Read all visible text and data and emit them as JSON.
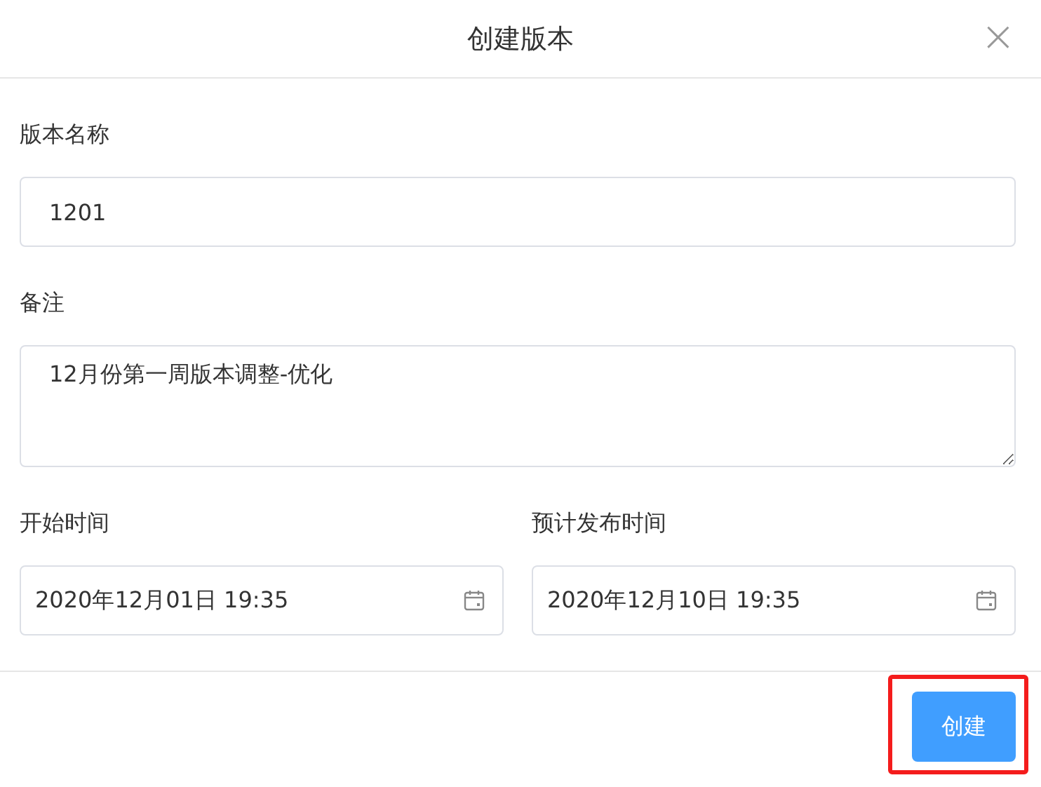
{
  "dialog": {
    "title": "创建版本",
    "close_icon": "×"
  },
  "fields": [
    {
      "kind": "input",
      "label": "版本名称",
      "value": "1201"
    },
    {
      "kind": "textarea",
      "label": "备注",
      "value": "12月份第一周版本调整-优化"
    }
  ],
  "dates": [
    {
      "label": "开始时间",
      "value": "2020年12月01日 19:35"
    },
    {
      "label": "预计发布时间",
      "value": "2020年12月10日 19:35"
    }
  ],
  "footer": {
    "button": {
      "label": "创建",
      "highlighted": true
    }
  }
}
